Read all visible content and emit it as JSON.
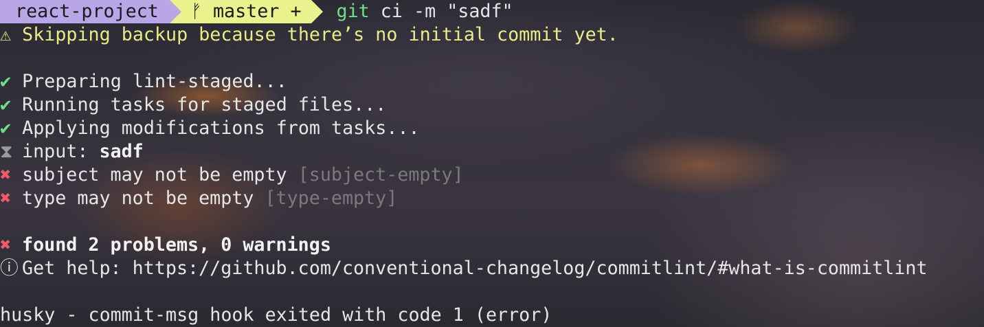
{
  "prompt": {
    "directory": "react-project",
    "branch_icon": "git-branch-icon",
    "branch_glyph": "ᚠ",
    "branch": "master",
    "dirty_marker": "+",
    "command_git": "git",
    "command_rest": " ci -m \"sadf\""
  },
  "warning": {
    "icon": "⚠",
    "text": "Skipping backup because there’s no initial commit yet."
  },
  "tasks": [
    {
      "icon": "✔",
      "text": "Preparing lint-staged..."
    },
    {
      "icon": "✔",
      "text": "Running tasks for staged files..."
    },
    {
      "icon": "✔",
      "text": "Applying modifications from tasks..."
    }
  ],
  "commitlint": {
    "input_icon": "⧗",
    "input_label": "input: ",
    "input_value": "sadf",
    "errors": [
      {
        "icon": "✖",
        "text": "subject may not be empty ",
        "rule": "[subject-empty]"
      },
      {
        "icon": "✖",
        "text": "type may not be empty ",
        "rule": "[type-empty]"
      }
    ],
    "summary_icon": "✖",
    "summary": "found 2 problems, 0 warnings",
    "help_icon": "ⓘ",
    "help_text": "Get help: https://github.com/conventional-changelog/commitlint/#what-is-commitlint"
  },
  "husky": {
    "text": "husky - commit-msg hook exited with code 1 (error)"
  },
  "colors": {
    "prompt_dir_bg": "#b9a6e6",
    "prompt_git_bg": "#e9f28c",
    "success": "#6ee08a",
    "warning": "#e7ec88",
    "error": "#f05a6a"
  }
}
